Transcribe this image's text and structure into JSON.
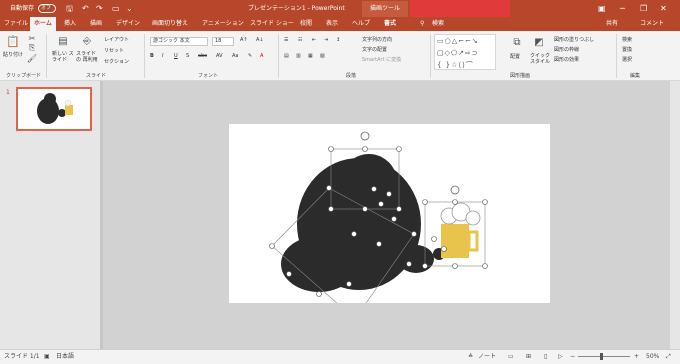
{
  "titlebar": {
    "autosave": "自動保存",
    "toggle": "オフ",
    "doc_title": "プレゼンテーション1 - PowerPoint",
    "context_tab": "描画ツール",
    "minimize": "─",
    "restore": "❐",
    "close": "✕"
  },
  "tabs": [
    "ファイル",
    "ホーム",
    "挿入",
    "描画",
    "デザイン",
    "画面切り替え",
    "アニメーション",
    "スライド ショー",
    "校閲",
    "表示",
    "ヘルプ",
    "書式"
  ],
  "tab_right": {
    "search": "検索",
    "share": "共有",
    "comment": "コメント"
  },
  "ribbon": {
    "paste": "貼り付け",
    "clipboard": "クリップボード",
    "new_slide": "新しい スライド",
    "reuse_slide": "スライドの 再利用",
    "layout": "レイアウト",
    "reset": "リセット",
    "section": "セクション",
    "slides": "スライド",
    "font_name": "游ゴシック 本文",
    "font_size": "18",
    "font": "フォント",
    "text_direction": "文字列の方向",
    "align_text": "文字の配置",
    "smartart": "SmartArt に変換",
    "paragraph": "段落",
    "arrange": "配置",
    "quick_styles": "クイック スタイル",
    "shape_fill": "図形の塗りつぶし",
    "shape_outline": "図形の枠線",
    "shape_effects": "図形の効果",
    "drawing": "図形描画",
    "find": "検索",
    "replace": "置換",
    "select": "選択",
    "editing": "編集"
  },
  "thumbnail": {
    "number": "1"
  },
  "statusbar": {
    "slide": "スライド 1/1",
    "lang": "日本語",
    "notes": "ノート",
    "zoom": "50%",
    "zoom_level": 0.5
  },
  "colors": {
    "accent": "#b7472a",
    "figure_dark": "#2b2b2b",
    "figure_gold": "#e8c44a"
  }
}
